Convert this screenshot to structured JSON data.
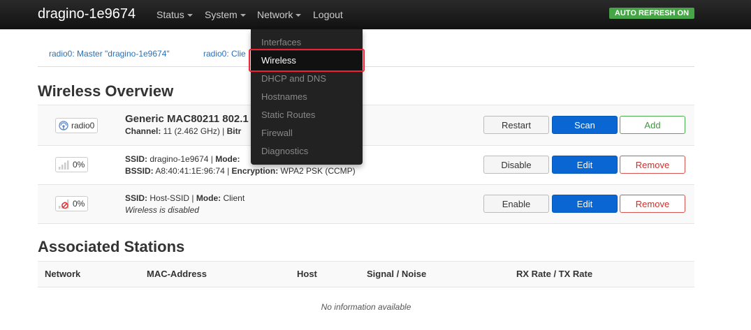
{
  "navbar": {
    "brand": "dragino-1e9674",
    "menu": [
      "Status",
      "System",
      "Network",
      "Logout"
    ],
    "auto_refresh": "AUTO REFRESH ON"
  },
  "network_menu": {
    "items": [
      "Interfaces",
      "Wireless",
      "DHCP and DNS",
      "Hostnames",
      "Static Routes",
      "Firewall",
      "Diagnostics"
    ],
    "active": "Wireless"
  },
  "tabs": [
    "radio0: Master \"dragino-1e9674\"",
    "radio0: Clie"
  ],
  "wireless_overview": {
    "title": "Wireless Overview",
    "radio": {
      "badge": "radio0",
      "name": "Generic MAC80211 802.1",
      "channel_label": "Channel:",
      "channel_value": " 11 (2.462 GHz) | ",
      "bitrate_label": "Bitr",
      "buttons": [
        "Restart",
        "Scan",
        "Add"
      ]
    },
    "networks": [
      {
        "signal": "0%",
        "ssid_label": "SSID:",
        "ssid_value": " dragino-1e9674 | ",
        "mode_label": "Mode:",
        "mode_value": "",
        "bssid_label": "BSSID:",
        "bssid_value": " A8:40:41:1E:96:74 | ",
        "enc_label": "Encryption:",
        "enc_value": " WPA2 PSK (CCMP)",
        "buttons": [
          "Disable",
          "Edit",
          "Remove"
        ]
      },
      {
        "signal": "0%",
        "ssid_label": "SSID:",
        "ssid_value": " Host-SSID | ",
        "mode_label": "Mode:",
        "mode_value": " Client",
        "status": "Wireless is disabled",
        "buttons": [
          "Enable",
          "Edit",
          "Remove"
        ]
      }
    ]
  },
  "associated_stations": {
    "title": "Associated Stations",
    "columns": [
      "Network",
      "MAC-Address",
      "Host",
      "Signal / Noise",
      "RX Rate / TX Rate"
    ],
    "empty": "No information available"
  }
}
